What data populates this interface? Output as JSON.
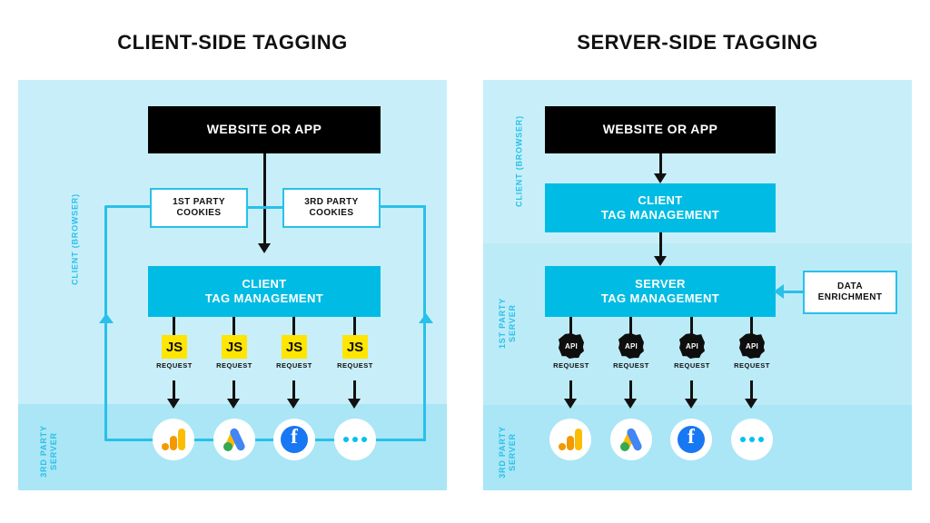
{
  "diagram": {
    "left": {
      "title": "CLIENT-SIDE TAGGING",
      "zones": [
        {
          "label": "CLIENT (BROWSER)"
        },
        {
          "label": "3RD PARTY\nSERVER"
        }
      ],
      "boxes": {
        "website": "WEBSITE OR APP",
        "first_party_cookies": "1ST PARTY\nCOOKIES",
        "third_party_cookies": "3RD PARTY\nCOOKIES",
        "tag_management": "CLIENT\nTAG MANAGEMENT"
      },
      "requests": [
        {
          "badge": "JS",
          "label": "REQUEST"
        },
        {
          "badge": "JS",
          "label": "REQUEST"
        },
        {
          "badge": "JS",
          "label": "REQUEST"
        },
        {
          "badge": "JS",
          "label": "REQUEST"
        }
      ],
      "platforms": [
        {
          "name": "google-analytics-icon"
        },
        {
          "name": "google-ads-icon"
        },
        {
          "name": "facebook-icon"
        },
        {
          "name": "more-options-icon"
        }
      ]
    },
    "right": {
      "title": "SERVER-SIDE TAGGING",
      "zones": [
        {
          "label": "CLIENT (BROWSER)"
        },
        {
          "label": "1ST PARTY\nSERVER"
        },
        {
          "label": "3RD PARTY\nSERVER"
        }
      ],
      "boxes": {
        "website": "WEBSITE OR APP",
        "client_tag_management": "CLIENT\nTAG MANAGEMENT",
        "server_tag_management": "SERVER\nTAG MANAGEMENT",
        "data_enrichment": "DATA\nENRICHMENT"
      },
      "requests": [
        {
          "badge": "API",
          "label": "REQUEST"
        },
        {
          "badge": "API",
          "label": "REQUEST"
        },
        {
          "badge": "API",
          "label": "REQUEST"
        },
        {
          "badge": "API",
          "label": "REQUEST"
        }
      ],
      "platforms": [
        {
          "name": "google-analytics-icon"
        },
        {
          "name": "google-ads-icon"
        },
        {
          "name": "facebook-icon"
        },
        {
          "name": "more-options-icon"
        }
      ]
    }
  },
  "colors": {
    "accent_cyan": "#00BCE4",
    "band_light": "#C8EFF9",
    "band_dark": "#AAE6F5",
    "badge_js": "#FFE500",
    "badge_api": "#0E0E0E",
    "black": "#000000"
  }
}
